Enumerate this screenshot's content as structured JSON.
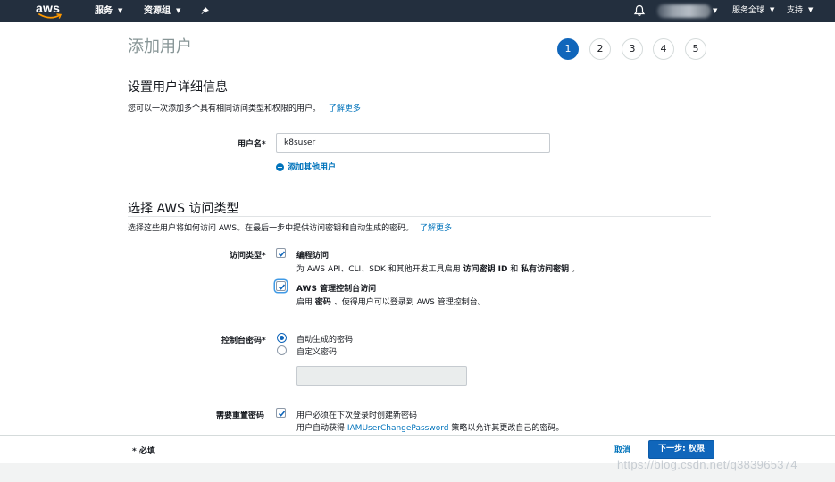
{
  "topnav": {
    "logo_text": "aws",
    "services_label": "服务",
    "resource_groups_label": "资源组",
    "pin_icon": "pin-icon",
    "bell_icon": "bell-icon",
    "region_label": "服务全球",
    "support_label": "支持"
  },
  "page_title": "添加用户",
  "steps": [
    "1",
    "2",
    "3",
    "4",
    "5"
  ],
  "active_step": "1",
  "details_section": {
    "title": "设置用户详细信息",
    "description": "您可以一次添加多个具有相同访问类型和权限的用户。",
    "learn_more": "了解更多",
    "username_label": "用户名*",
    "username_value": "k8suser",
    "add_user_label": "添加其他用户"
  },
  "access_section": {
    "title": "选择 AWS 访问类型",
    "description": "选择这些用户将如何访问 AWS。在最后一步中提供访问密钥和自动生成的密码。",
    "learn_more": "了解更多",
    "access_type_label": "访问类型*",
    "programmatic": {
      "title": "编程访问",
      "desc_prefix": "为 AWS API、CLI、SDK 和其他开发工具启用 ",
      "desc_bold1": "访问密钥 ID",
      "desc_mid": " 和 ",
      "desc_bold2": "私有访问密钥",
      "desc_suffix": " 。",
      "checked": true
    },
    "console": {
      "title": "AWS 管理控制台访问",
      "desc_prefix": "启用 ",
      "desc_bold": "密码",
      "desc_suffix": " 、使得用户可以登录到 AWS 管理控制台。",
      "checked": true
    },
    "console_password_label": "控制台密码*",
    "password_options": [
      "自动生成的密码",
      "自定义密码"
    ],
    "selected_password_option": "自动生成的密码",
    "custom_password_value": "",
    "reset_label": "需要重置密码",
    "reset_text": "用户必须在下次登录时创建新密码",
    "reset_desc_prefix": "用户自动获得 ",
    "reset_desc_link": "IAMUserChangePassword",
    "reset_desc_suffix": " 策略以允许其更改自己的密码。",
    "reset_checked": true
  },
  "footer": {
    "required_note": "* 必填",
    "cancel_label": "取消",
    "next_label": "下一步: 权限"
  },
  "watermark": "https://blog.csdn.net/q383965374",
  "colors": {
    "topbar": "#232f3e",
    "primary": "#1066bb",
    "link": "#0073bb"
  }
}
